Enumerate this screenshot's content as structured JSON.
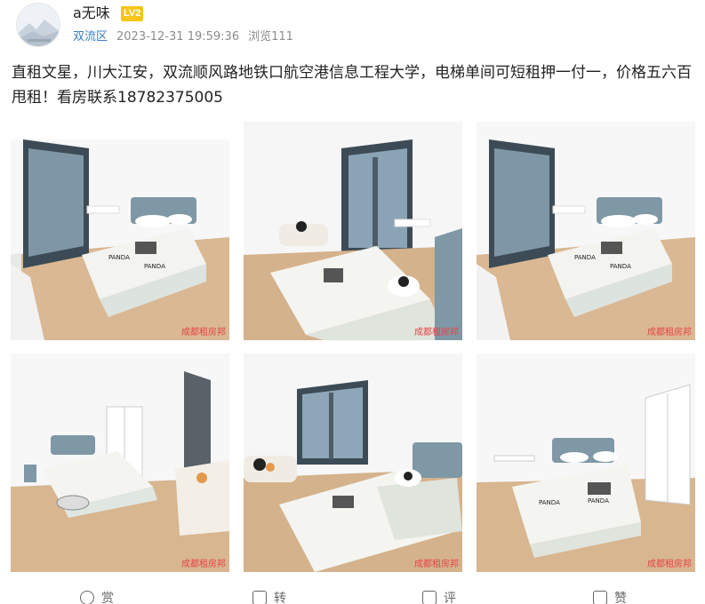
{
  "post": {
    "username": "a无味",
    "level": "LV2",
    "district": "双流区",
    "timestamp": "2023-12-31 19:59:36",
    "views": "浏览111",
    "text": "直租文星，川大江安，双流顺风路地铁口航空港信息工程大学，电梯单间可短租押一付一，价格五六百甩租！看房联系18782375005"
  },
  "photos": [
    {
      "watermark": "成都租房邦"
    },
    {
      "watermark": "成都租房邦"
    },
    {
      "watermark": "成都租房邦"
    },
    {
      "watermark": "成都租房邦"
    },
    {
      "watermark": "成都租房邦"
    },
    {
      "watermark": "成都租房邦"
    }
  ],
  "actions": {
    "reward": "赏",
    "share": "转",
    "comment": "评",
    "like": "赞"
  },
  "colors": {
    "district_link": "#3a7fc4",
    "level_badge": "#f5c518",
    "watermark": "#e64545"
  }
}
